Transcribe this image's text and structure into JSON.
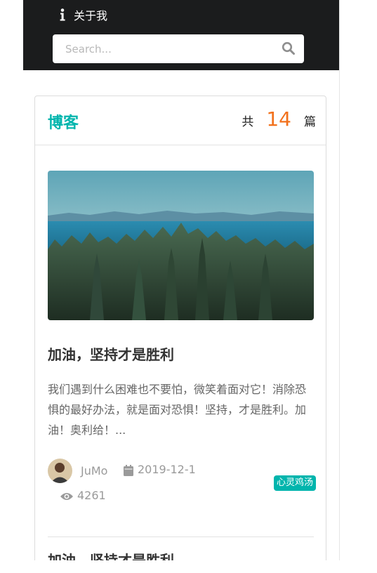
{
  "nav": {
    "about_label": "关于我",
    "about_icon": "info-icon",
    "bg_color": "#1b1c1d"
  },
  "search": {
    "placeholder": "Search...",
    "icon": "search-icon"
  },
  "blog": {
    "title": "博客",
    "count_prefix": "共",
    "count": "14",
    "count_suffix": "篇",
    "accent_color": "#00b5ad",
    "count_color": "#f2711c"
  },
  "posts": [
    {
      "title": "加油，坚持才是胜利",
      "excerpt": "我们遇到什么困难也不要怕，微笑着面对它！消除恐惧的最好办法，就是面对恐惧！坚持，才是胜利。加油！奥利给！...",
      "author": "JuMo",
      "date": "2019-12-1",
      "views": "4261",
      "tag": "心灵鸡汤",
      "date_icon": "calendar-icon",
      "views_icon": "eye-icon"
    },
    {
      "title": "加油，坚持才是胜利"
    }
  ]
}
